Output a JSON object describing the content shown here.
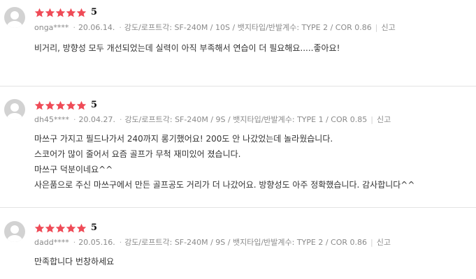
{
  "colors": {
    "star": "#ef4b57",
    "avatar_bg": "#d2d2d2",
    "avatar_fg": "#ffffff",
    "meta_text": "#8a8a8a",
    "divider": "#e3e3e3"
  },
  "icons": {
    "star": "star-icon",
    "avatar": "user-silhouette-icon"
  },
  "reviews": [
    {
      "rating": 5,
      "score_label": "5",
      "user": "onga****",
      "date": "20.06.14.",
      "options": "강도/로프트각: SF-240M / 10S / 뱃지타입/반발계수: TYPE 2 / COR 0.86",
      "report_label": "신고",
      "body_lines": [
        "비거리, 방향성 모두 개선되었는데 실력이 아직 부족해서 연습이 더 필요해요.....좋아요!"
      ]
    },
    {
      "rating": 5,
      "score_label": "5",
      "user": "dh45****",
      "date": "20.04.27.",
      "options": "강도/로프트각: SF-240M / 9S / 뱃지타입/반발계수: TYPE 1 / COR 0.85",
      "report_label": "신고",
      "body_lines": [
        "마쓰구 가지고 필드나가서 240까지 롱기했어요! 200도 안 나갔었는데 놀라웠습니다.",
        "스코어가 많이 줄어서 요즘 골프가 무척 재미있어 졌습니다.",
        "마쓰구 덕분이네요^^",
        "사은품으로 주신 마쓰구에서 만든 골프공도 거리가 더 나갔어요. 방향성도 아주 정확했습니다. 감사합니다^^"
      ]
    },
    {
      "rating": 5,
      "score_label": "5",
      "user": "dadd****",
      "date": "20.05.16.",
      "options": "강도/로프트각: SF-240M / 9S / 뱃지타입/반발계수: TYPE 2 / COR 0.86",
      "report_label": "신고",
      "body_lines": [
        "만족합니다 번창하세요"
      ]
    }
  ]
}
